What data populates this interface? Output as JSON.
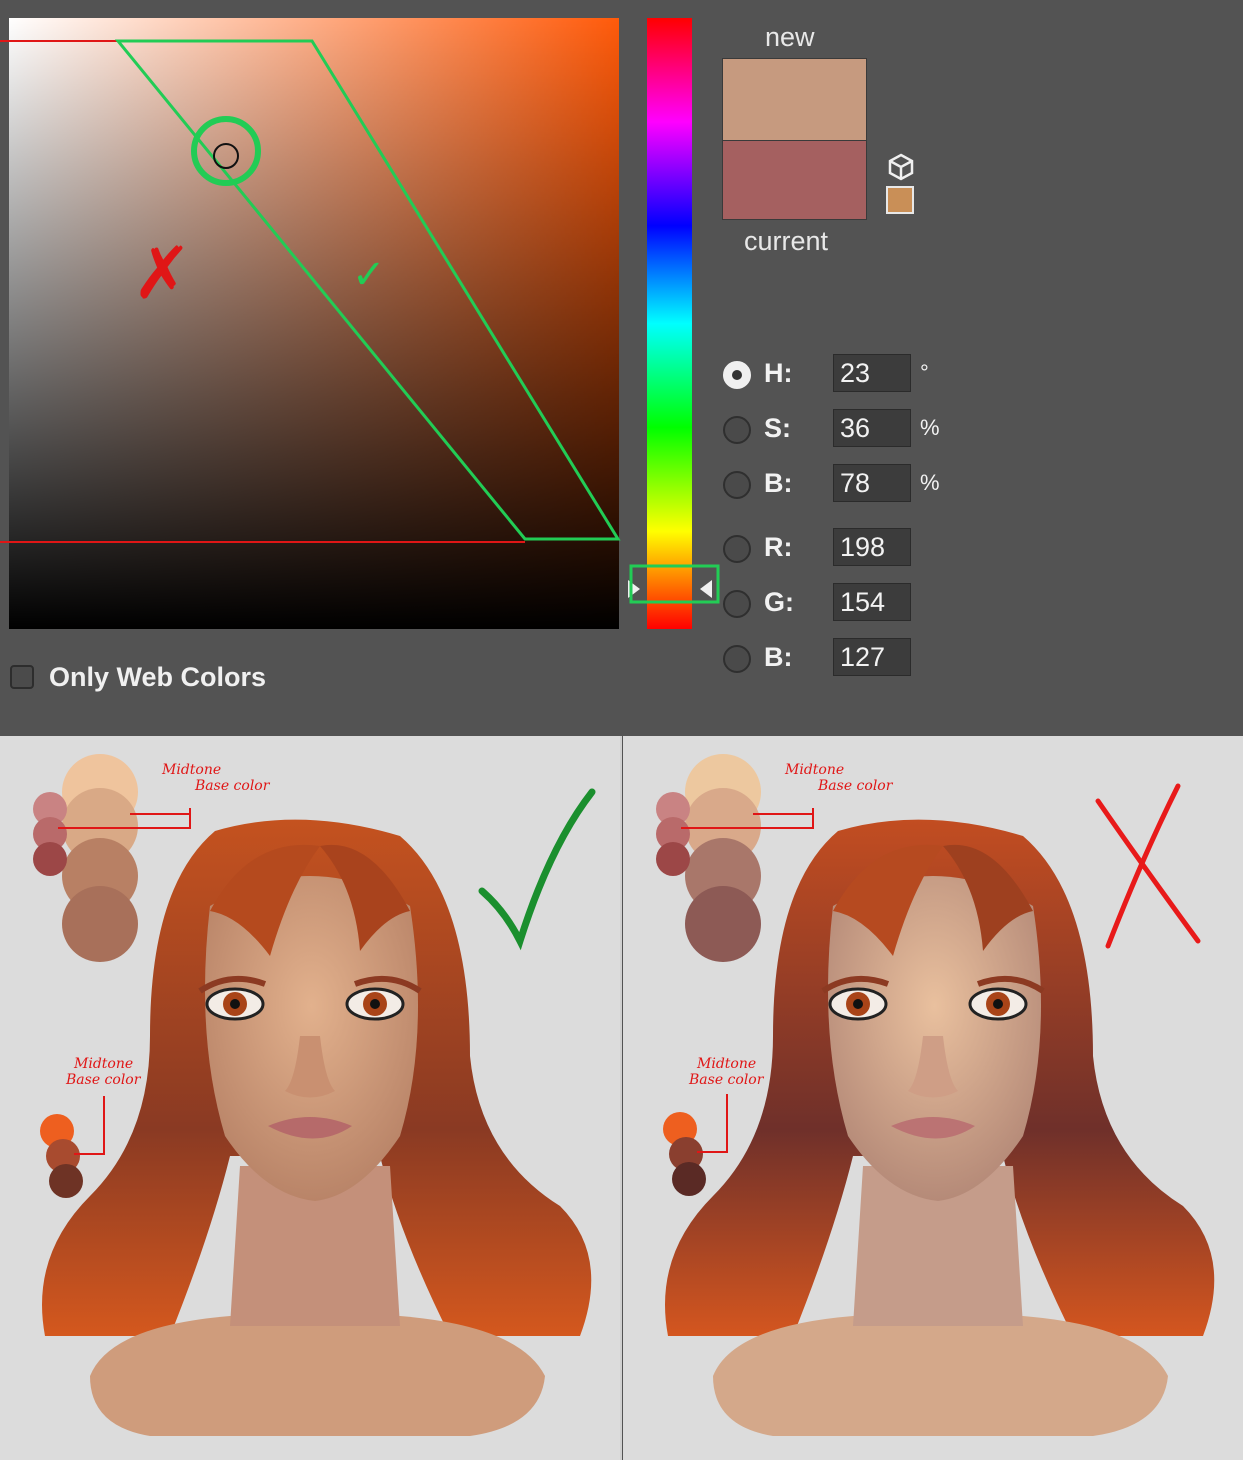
{
  "color_picker": {
    "new_label": "new",
    "current_label": "current",
    "new_color": "#c69a7f",
    "current_color": "#a56060",
    "fields": {
      "H": {
        "label": "H:",
        "value": "23",
        "unit": "°",
        "selected": true
      },
      "S": {
        "label": "S:",
        "value": "36",
        "unit": "%"
      },
      "Bri": {
        "label": "B:",
        "value": "78",
        "unit": "%"
      },
      "R": {
        "label": "R:",
        "value": "198"
      },
      "G": {
        "label": "G:",
        "value": "154"
      },
      "Blue": {
        "label": "B:",
        "value": "127"
      }
    },
    "only_web_colors_label": "Only Web Colors",
    "only_web_colors_checked": false
  },
  "annotations": {
    "wrong_mark": "✗",
    "right_mark": "✓"
  },
  "examples": {
    "left": {
      "skin_label_1": "Midtone",
      "skin_label_2": "Base color",
      "hair_label_1": "Midtone",
      "hair_label_2": "Base color",
      "verdict": "✓",
      "verdict_color": "#1b8f2e",
      "skin_swatches": [
        "#efc49d",
        "#d9a986",
        "#b88064",
        "#a8705a"
      ],
      "small_swatches": [
        "#c98383",
        "#b96a6a",
        "#9c4747"
      ],
      "hair_swatches": [
        "#ee5f1f",
        "#a84b2f",
        "#6e3325"
      ],
      "skin_tone": "#d8a582",
      "hair_tone": "#c0491e"
    },
    "right": {
      "skin_label_1": "Midtone",
      "skin_label_2": "Base color",
      "hair_label_1": "Midtone",
      "hair_label_2": "Base color",
      "verdict": "✗",
      "verdict_color": "#e81a1a",
      "skin_swatches": [
        "#edc89f",
        "#d9a98a",
        "#a9776a",
        "#8d5a55"
      ],
      "small_swatches": [
        "#c98383",
        "#b96a6a",
        "#9c4747"
      ],
      "hair_swatches": [
        "#ee5f1f",
        "#8a3f2f",
        "#5a2a25"
      ],
      "skin_tone": "#dcb08e",
      "hair_tone": "#b64522"
    }
  }
}
